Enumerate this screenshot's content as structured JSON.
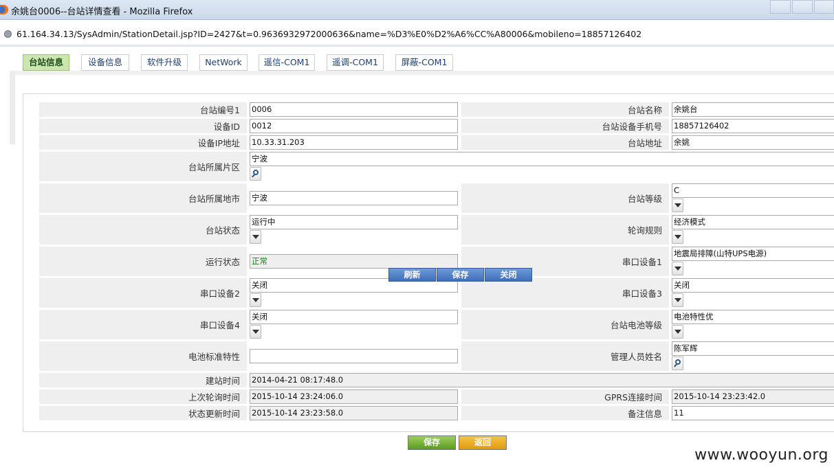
{
  "window": {
    "title": "余姚台0006--台站详情查看 - Mozilla Firefox"
  },
  "address": {
    "url": "61.164.34.13/SysAdmin/StationDetail.jsp?ID=2427&t=0.9636932972000636&name=%D3%E0%D2%A6%CC%A80006&mobileno=18857126402"
  },
  "tabs": [
    "台站信息",
    "设备信息",
    "软件升级",
    "NetWork",
    "遥信-COM1",
    "遥调-COM1",
    "屏蔽-COM1"
  ],
  "form": {
    "station_no": {
      "label": "台站编号1",
      "value": "0006"
    },
    "station_name": {
      "label": "台站名称",
      "value": "余姚台"
    },
    "device_id": {
      "label": "设备ID",
      "value": "0012"
    },
    "device_phone": {
      "label": "台站设备手机号",
      "value": "18857126402"
    },
    "device_ip": {
      "label": "设备IP地址",
      "value": "10.33.31.203"
    },
    "station_address": {
      "label": "台站地址",
      "value": "余姚"
    },
    "district": {
      "label": "台站所属片区",
      "value": "宁波"
    },
    "city": {
      "label": "台站所属地市",
      "value": "宁波"
    },
    "level": {
      "label": "台站等级",
      "value": "C"
    },
    "status": {
      "label": "台站状态",
      "value": "运行中"
    },
    "poll_rule": {
      "label": "轮询规则",
      "value": "经济模式"
    },
    "run_status": {
      "label": "运行状态",
      "value": "正常"
    },
    "serial1": {
      "label": "串口设备1",
      "value": "地震局排障(山特UPS电源)"
    },
    "serial2": {
      "label": "串口设备2",
      "value": "关闭"
    },
    "serial3": {
      "label": "串口设备3",
      "value": "关闭"
    },
    "serial4": {
      "label": "串口设备4",
      "value": "关闭"
    },
    "battery_level": {
      "label": "台站电池等级",
      "value": "电池特性优"
    },
    "battery_std": {
      "label": "电池标准特性",
      "value": ""
    },
    "manager": {
      "label": "管理人员姓名",
      "value": "陈军辉"
    },
    "built_time": {
      "label": "建站时间",
      "value": "2014-04-21 08:17:48.0"
    },
    "last_poll": {
      "label": "上次轮询时间",
      "value": "2015-10-14 23:24:06.0"
    },
    "gprs_time": {
      "label": "GPRS连接时间",
      "value": "2015-10-14 23:23:42.0"
    },
    "status_update": {
      "label": "状态更新时间",
      "value": "2015-10-14 23:23:58.0"
    },
    "remark": {
      "label": "备注信息",
      "value": "11"
    }
  },
  "popup": {
    "refresh": "刷新",
    "save": "保存",
    "close": "关闭"
  },
  "buttons": {
    "save": "保存",
    "back": "返回"
  },
  "watermark": "www.wooyun.org"
}
